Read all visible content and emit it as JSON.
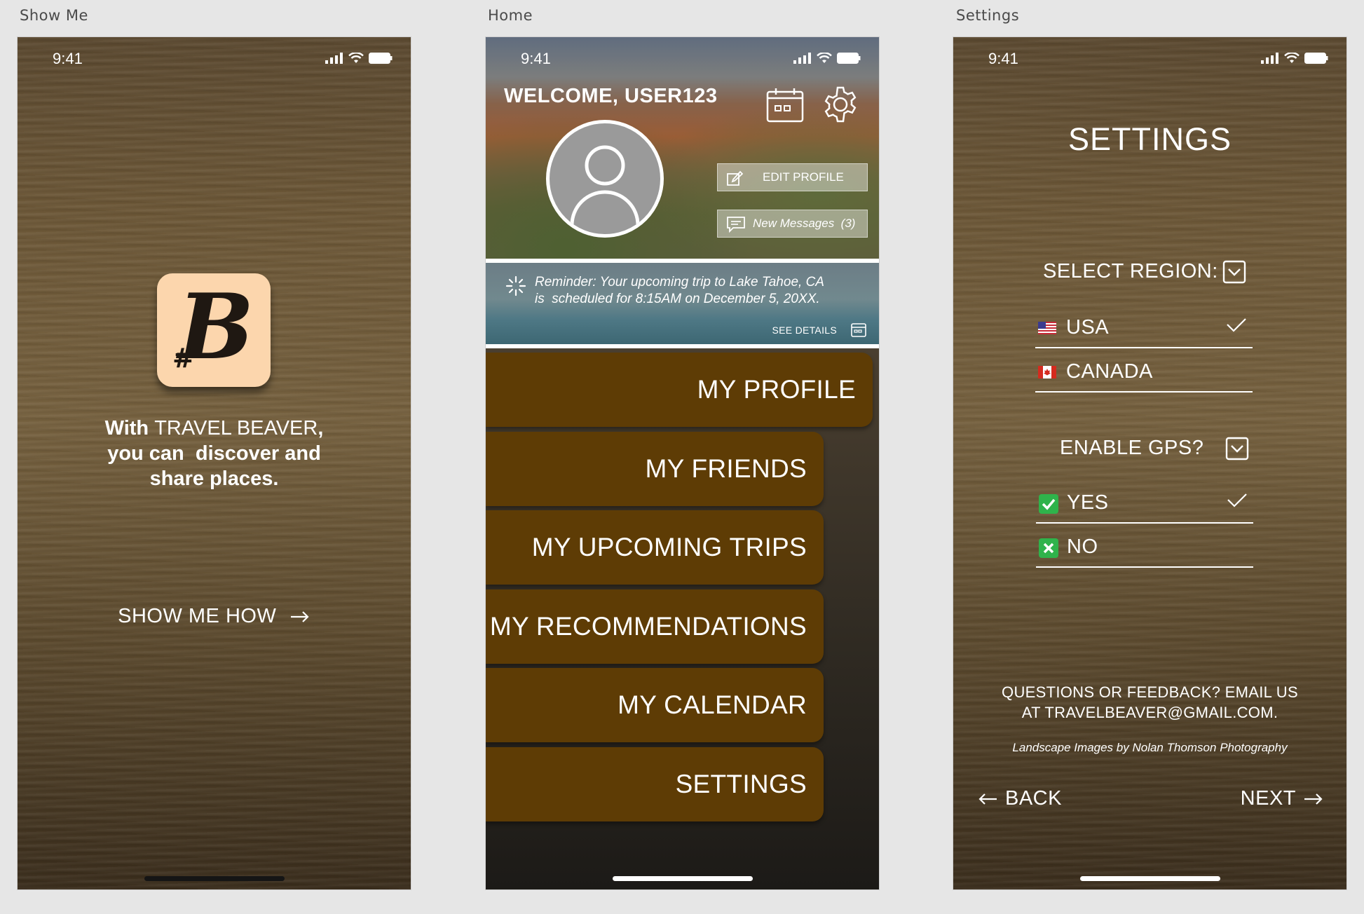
{
  "artboards": {
    "show_me": "Show Me",
    "home": "Home",
    "settings": "Settings"
  },
  "status": {
    "time": "9:41"
  },
  "screen1": {
    "logo_letter": "B",
    "logo_hash": "#",
    "tagline_with": "With",
    "tagline_brand": "TRAVEL BEAVER",
    "tagline_comma": ",",
    "tagline_line2": "you can  discover and",
    "tagline_line3": "share places.",
    "show_me_how": "SHOW ME HOW"
  },
  "home": {
    "welcome": "WELCOME, USER123",
    "edit_profile": "EDIT PROFILE",
    "new_messages": "New Messages  (3)",
    "reminder_line1": "Reminder: Your upcoming trip to Lake Tahoe, CA",
    "reminder_line2": "is  scheduled for 8:15AM on December 5, 20XX.",
    "see_details": "SEE DETAILS",
    "menu": [
      {
        "label": "MY PROFILE"
      },
      {
        "label": "MY FRIENDS"
      },
      {
        "label": "MY UPCOMING TRIPS"
      },
      {
        "label": "MY RECOMMENDATIONS"
      },
      {
        "label": "MY CALENDAR"
      },
      {
        "label": "SETTINGS"
      }
    ],
    "icons": [
      "calendar-icon",
      "gear-icon",
      "user-icon",
      "edit-icon",
      "message-icon",
      "loading-icon"
    ]
  },
  "settings": {
    "title": "SETTINGS",
    "select_region": "SELECT REGION:",
    "region_options": [
      {
        "label": "USA",
        "selected": true,
        "flag": "us-flag-icon"
      },
      {
        "label": "CANADA",
        "selected": false,
        "flag": "ca-flag-icon"
      }
    ],
    "enable_gps": "ENABLE GPS?",
    "gps_options": [
      {
        "label": "YES",
        "selected": true
      },
      {
        "label": "NO",
        "selected": false
      }
    ],
    "feedback_line1": "QUESTIONS OR FEEDBACK? EMAIL US",
    "feedback_line2": "AT TRAVELBEAVER@GMAIL.COM.",
    "credit": "Landscape Images by Nolan Thomson Photography",
    "back": "BACK",
    "next": "NEXT"
  },
  "colors": {
    "menu_button": "#5e3c05",
    "logo_bg": "#fcd6ad",
    "check_green": "#2fb34b"
  }
}
